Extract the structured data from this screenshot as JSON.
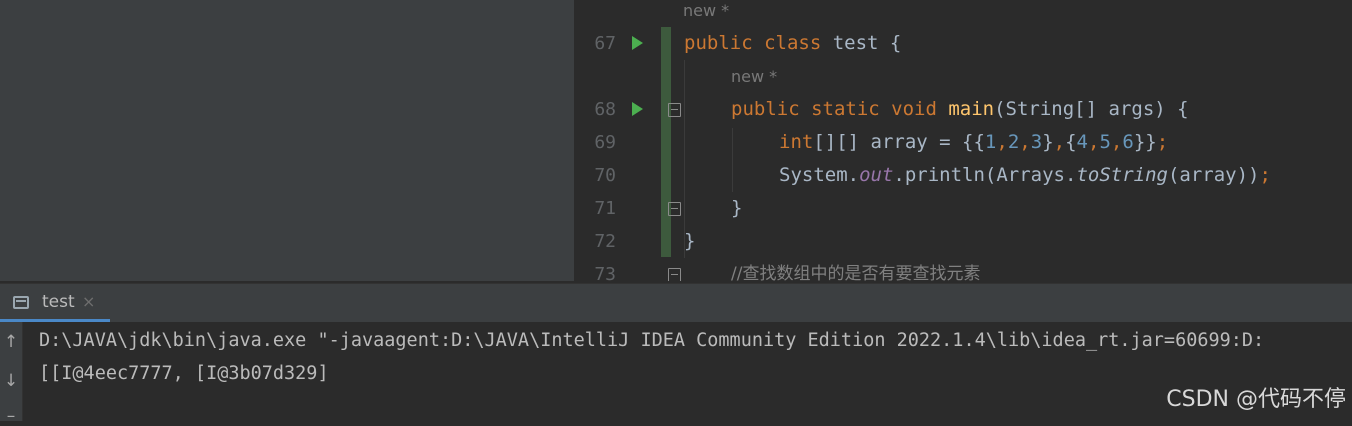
{
  "editor": {
    "hint_class": "new *",
    "hint_main": "new *",
    "lines": {
      "l67": {
        "num": "67",
        "kw1": "public ",
        "kw2": "class ",
        "rest": "test {"
      },
      "l68": {
        "num": "68",
        "kw": "public static void ",
        "fn": "main",
        "rest": "(String[] args) {"
      },
      "l69": {
        "num": "69",
        "kw": "int",
        "a": "[][] array = {{",
        "n1": "1",
        "c1": ",",
        "n2": "2",
        "c2": ",",
        "n3": "3",
        "b1": "}",
        "c3": ",",
        "b2": "{",
        "n4": "4",
        "c4": ",",
        "n5": "5",
        "c5": ",",
        "n6": "6",
        "b3": "}}",
        "semi": ";"
      },
      "l70": {
        "num": "70",
        "a": "System.",
        "field": "out",
        "b": ".println(Arrays.",
        "st": "toString",
        "c": "(array))",
        "semi": ";"
      },
      "l71": {
        "num": "71",
        "text": "}"
      },
      "l72": {
        "num": "72",
        "text": "}"
      },
      "l73": {
        "num": "73",
        "comment": "//查找数组中的是否有要查找元素"
      }
    }
  },
  "tool_window": {
    "tab_label": "test",
    "tab_close": "×"
  },
  "console": {
    "line1": "D:\\JAVA\\jdk\\bin\\java.exe \"-javaagent:D:\\JAVA\\IntelliJ IDEA Community Edition 2022.1.4\\lib\\idea_rt.jar=60699:D:",
    "line2": "[[I@4eec7777, [I@3b07d329]"
  },
  "toolbar_icons": [
    "arrow-up-icon",
    "arrow-down-icon",
    "wrap-icon"
  ],
  "watermark": "CSDN @代码不停",
  "colors": {
    "keyword": "#cc7832",
    "function": "#ffc66d",
    "number": "#6897bb",
    "field": "#9876aa",
    "run_icon": "#4caf50"
  }
}
